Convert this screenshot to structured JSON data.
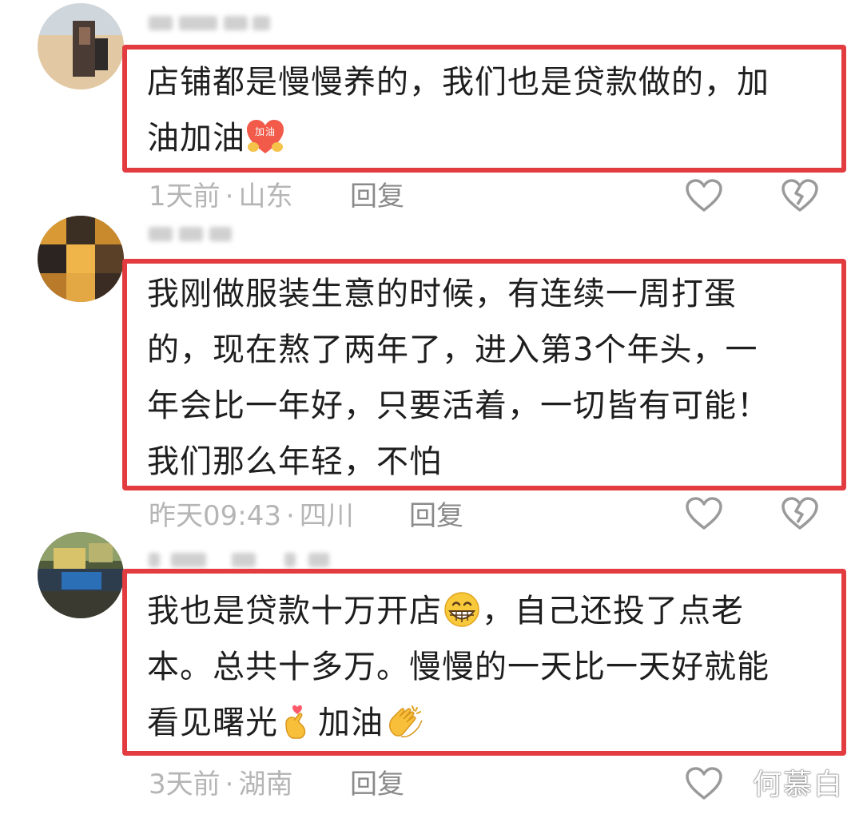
{
  "comments": [
    {
      "text": "店铺都是慢慢养的，我们也是贷款做的，加\n油加油",
      "emoji_after": "jiayou-badge-icon",
      "emoji_badge_text": "加油",
      "time": "1天前",
      "location": "山东",
      "reply_label": "回复"
    },
    {
      "text": "我刚做服装生意的时候，有连续一周打蛋\n的，现在熬了两年了，进入第3个年头，一\n年会比一年好，只要活着，一切皆有可能！\n我们那么年轻，不怕",
      "time": "昨天09:43",
      "location": "四川",
      "reply_label": "回复"
    },
    {
      "text_part1": "我也是贷款十万开店",
      "text_part2": "，自己还投了点老\n本。总共十多万。慢慢的一天比一天好就能\n看见曙光",
      "text_part3": "加油",
      "time": "3天前",
      "location": "湖南",
      "reply_label": "回复"
    }
  ],
  "separator": "·",
  "watermark": "何慕白",
  "colors": {
    "highlight_border": "#e23b40",
    "meta_text": "#b5b5b5",
    "icon_stroke": "#9a9a9a"
  }
}
